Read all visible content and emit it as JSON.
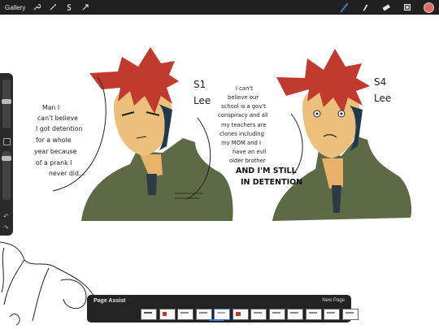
{
  "topbar": {
    "gallery_label": "Gallery",
    "left_tools": [
      "wrench-icon",
      "magic-wand-icon",
      "selection-icon",
      "transform-icon"
    ],
    "right_tools": [
      "brush-icon",
      "smudge-icon",
      "eraser-icon",
      "layers-icon"
    ],
    "active_color": "#e06a62",
    "accent_color": "#3d7bd8"
  },
  "canvas": {
    "left_text": [
      "Man I",
      "can't believe",
      "I got detention",
      "for a whole",
      "year because",
      "of a prank I",
      "never did..."
    ],
    "label_s1": "S1",
    "label_s1_name": "Lee",
    "label_s4": "S4",
    "label_s4_name": "Lee",
    "middle_text": [
      "I can't",
      "believe our",
      "school is a gov't",
      "conspiracy and all",
      "my teachers are",
      "clones including",
      "my MOM and I",
      "have an evil",
      "older brother"
    ],
    "shout_1": "AND I'M STILL",
    "shout_2": "IN DETENTION"
  },
  "page_assist": {
    "title": "Page Assist",
    "new_page_label": "New Page",
    "page_count": 12,
    "selected_page": 5
  }
}
